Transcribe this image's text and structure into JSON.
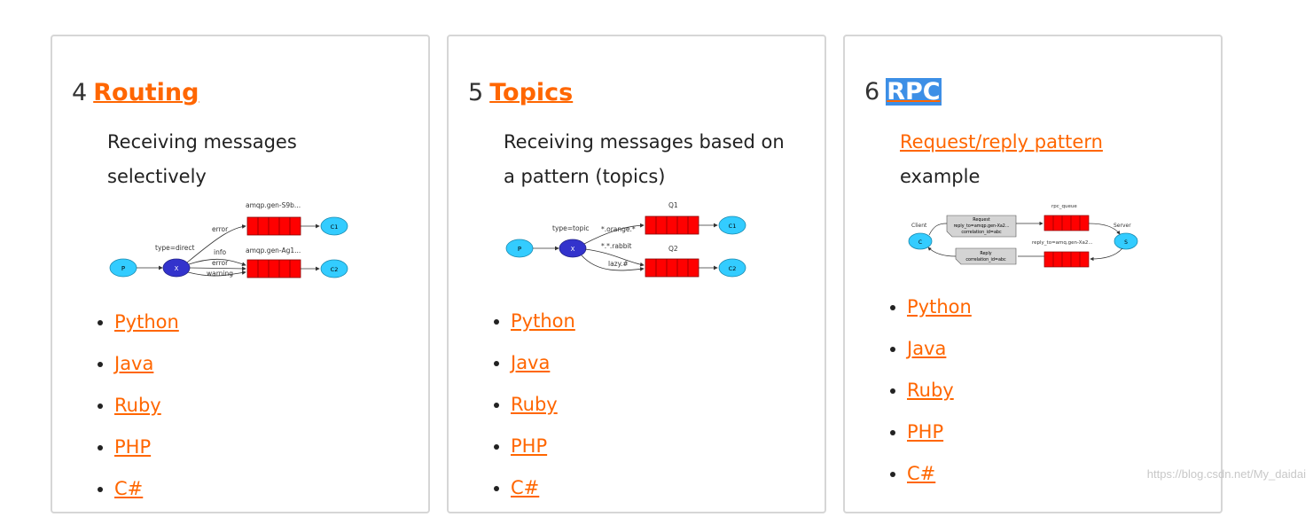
{
  "cards": [
    {
      "number": "4",
      "title": "Routing",
      "description": "Receiving messages selectively",
      "diagram": {
        "producer": "P",
        "exchange": "X",
        "exchange_type": "type=direct",
        "queue1": "amqp.gen-S9b...",
        "queue2": "amqp.gen-Ag1...",
        "bindings": [
          "error",
          "info",
          "error",
          "warning"
        ],
        "consumer1": "C1",
        "consumer2": "C2"
      },
      "languages": [
        "Python",
        "Java",
        "Ruby",
        "PHP",
        "C#"
      ]
    },
    {
      "number": "5",
      "title": "Topics",
      "description": "Receiving messages based on a pattern (topics)",
      "diagram": {
        "producer": "P",
        "exchange": "X",
        "exchange_type": "type=topic",
        "queue1": "Q1",
        "queue2": "Q2",
        "bindings": [
          "*.orange.*",
          "*.*.rabbit",
          "lazy.#"
        ],
        "consumer1": "C1",
        "consumer2": "C2"
      },
      "languages": [
        "Python",
        "Java",
        "Ruby",
        "PHP",
        "C#"
      ]
    },
    {
      "number": "6",
      "title": "RPC",
      "description_link": "Request/reply pattern",
      "description_rest": "example",
      "diagram": {
        "client_label": "Client",
        "client": "C",
        "server_label": "Server",
        "server": "S",
        "queue1": "rpc_queue",
        "queue2": "reply_to=amq.gen-Xa2...",
        "request_box": [
          "Request",
          "reply_to=amqp.gen-Xa2...",
          "correlation_id=abc"
        ],
        "reply_box": [
          "Reply",
          "correlation_id=abc"
        ]
      },
      "languages": [
        "Python",
        "Java",
        "Ruby",
        "PHP",
        "C#"
      ]
    }
  ],
  "watermark": "https://blog.csdn.net/My_daidai",
  "colors": {
    "link": "#ff6600",
    "queue": "#ff0000",
    "node": "#33ccff",
    "exchange": "#3333cc"
  }
}
